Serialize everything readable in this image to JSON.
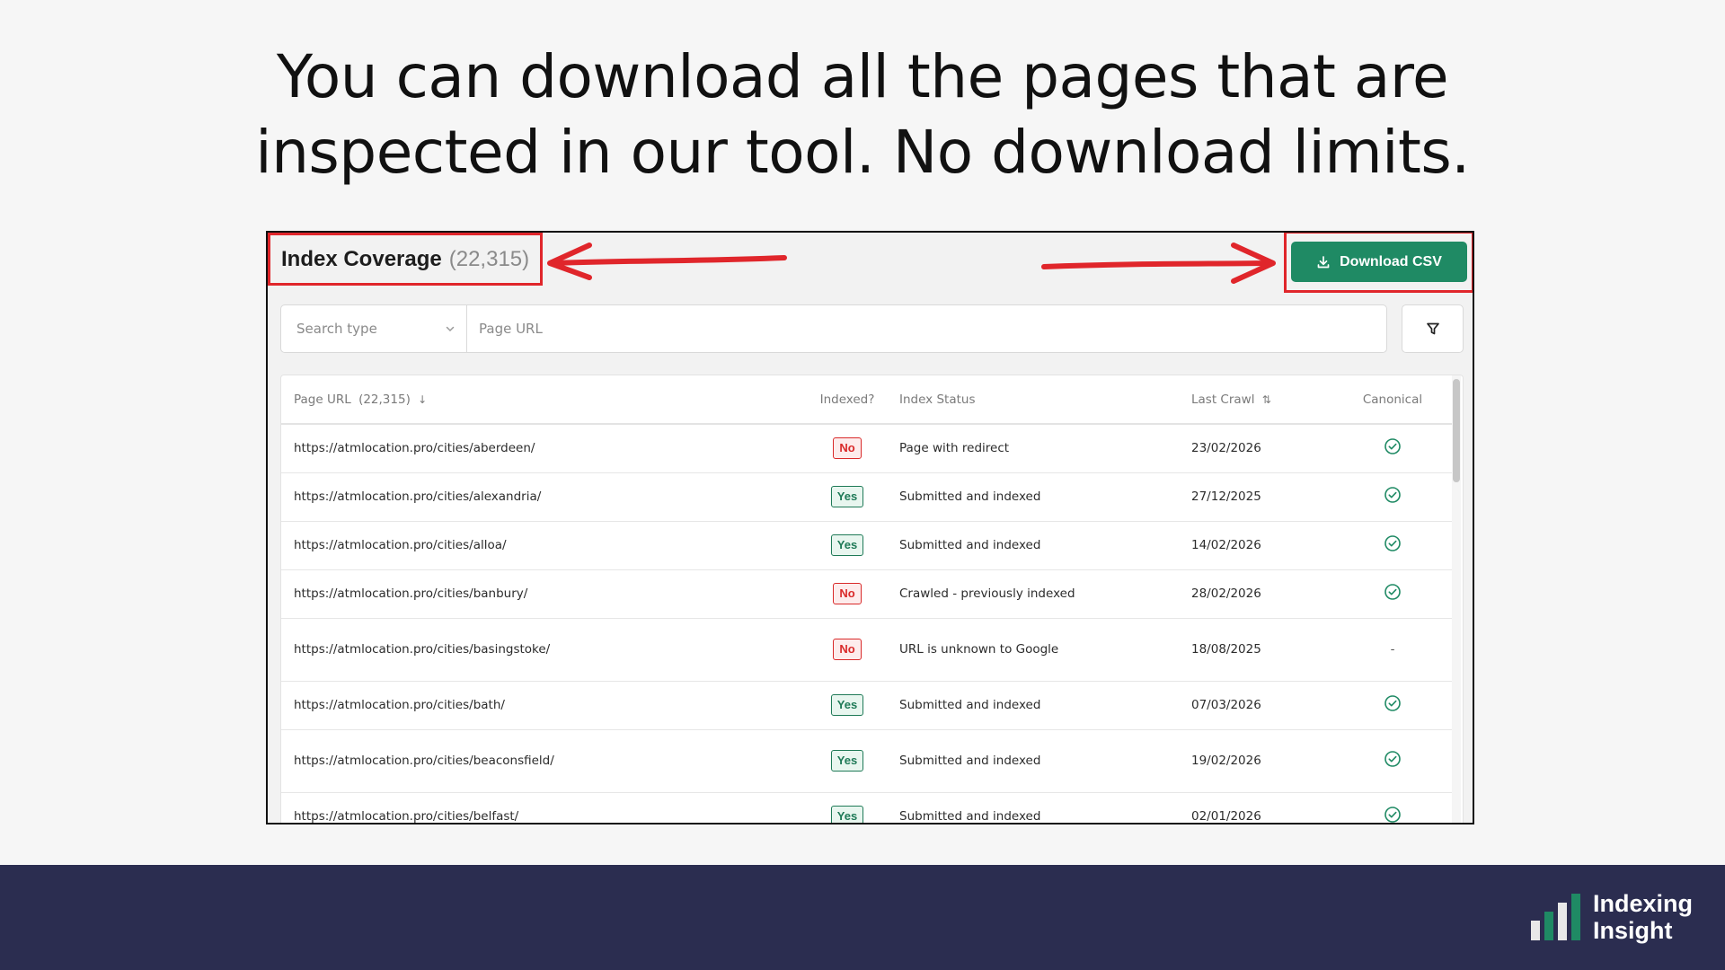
{
  "headline": {
    "line1": "You can download all the pages that are",
    "line2": "inspected in our tool. No download limits."
  },
  "panel": {
    "title": "Index Coverage",
    "count": "(22,315)",
    "download_label": "Download CSV"
  },
  "search": {
    "type_placeholder": "Search type",
    "url_placeholder": "Page URL"
  },
  "table": {
    "headers": {
      "url": "Page URL",
      "url_count": "(22,315)",
      "indexed": "Indexed?",
      "status": "Index Status",
      "last_crawl": "Last Crawl",
      "canonical": "Canonical"
    },
    "rows": [
      {
        "url": "https://atmlocation.pro/cities/aberdeen/",
        "indexed": "No",
        "status": "Page with redirect",
        "last_crawl": "23/02/2026",
        "canonical": "check"
      },
      {
        "url": "https://atmlocation.pro/cities/alexandria/",
        "indexed": "Yes",
        "status": "Submitted and indexed",
        "last_crawl": "27/12/2025",
        "canonical": "check"
      },
      {
        "url": "https://atmlocation.pro/cities/alloa/",
        "indexed": "Yes",
        "status": "Submitted and indexed",
        "last_crawl": "14/02/2026",
        "canonical": "check"
      },
      {
        "url": "https://atmlocation.pro/cities/banbury/",
        "indexed": "No",
        "status": "Crawled - previously indexed",
        "last_crawl": "28/02/2026",
        "canonical": "check"
      },
      {
        "url": "https://atmlocation.pro/cities/basingstoke/",
        "indexed": "No",
        "status": "URL is unknown to Google",
        "last_crawl": "18/08/2025",
        "canonical": "-"
      },
      {
        "url": "https://atmlocation.pro/cities/bath/",
        "indexed": "Yes",
        "status": "Submitted and indexed",
        "last_crawl": "07/03/2026",
        "canonical": "check"
      },
      {
        "url": "https://atmlocation.pro/cities/beaconsfield/",
        "indexed": "Yes",
        "status": "Submitted and indexed",
        "last_crawl": "19/02/2026",
        "canonical": "check"
      },
      {
        "url": "https://atmlocation.pro/cities/belfast/",
        "indexed": "Yes",
        "status": "Submitted and indexed",
        "last_crawl": "02/01/2026",
        "canonical": "check"
      }
    ]
  },
  "brand": {
    "line1": "Indexing",
    "line2": "Insight"
  },
  "colors": {
    "accent_green": "#1f8a64",
    "highlight_red": "#e0262b",
    "footer_navy": "#2b2d50"
  },
  "icons": {
    "download": "download-icon",
    "chevron": "chevron-down-icon",
    "filter": "filter-icon",
    "sort_down": "arrow-down-icon",
    "sort_both": "sort-icon",
    "canonical_ok": "check-circle-icon"
  }
}
